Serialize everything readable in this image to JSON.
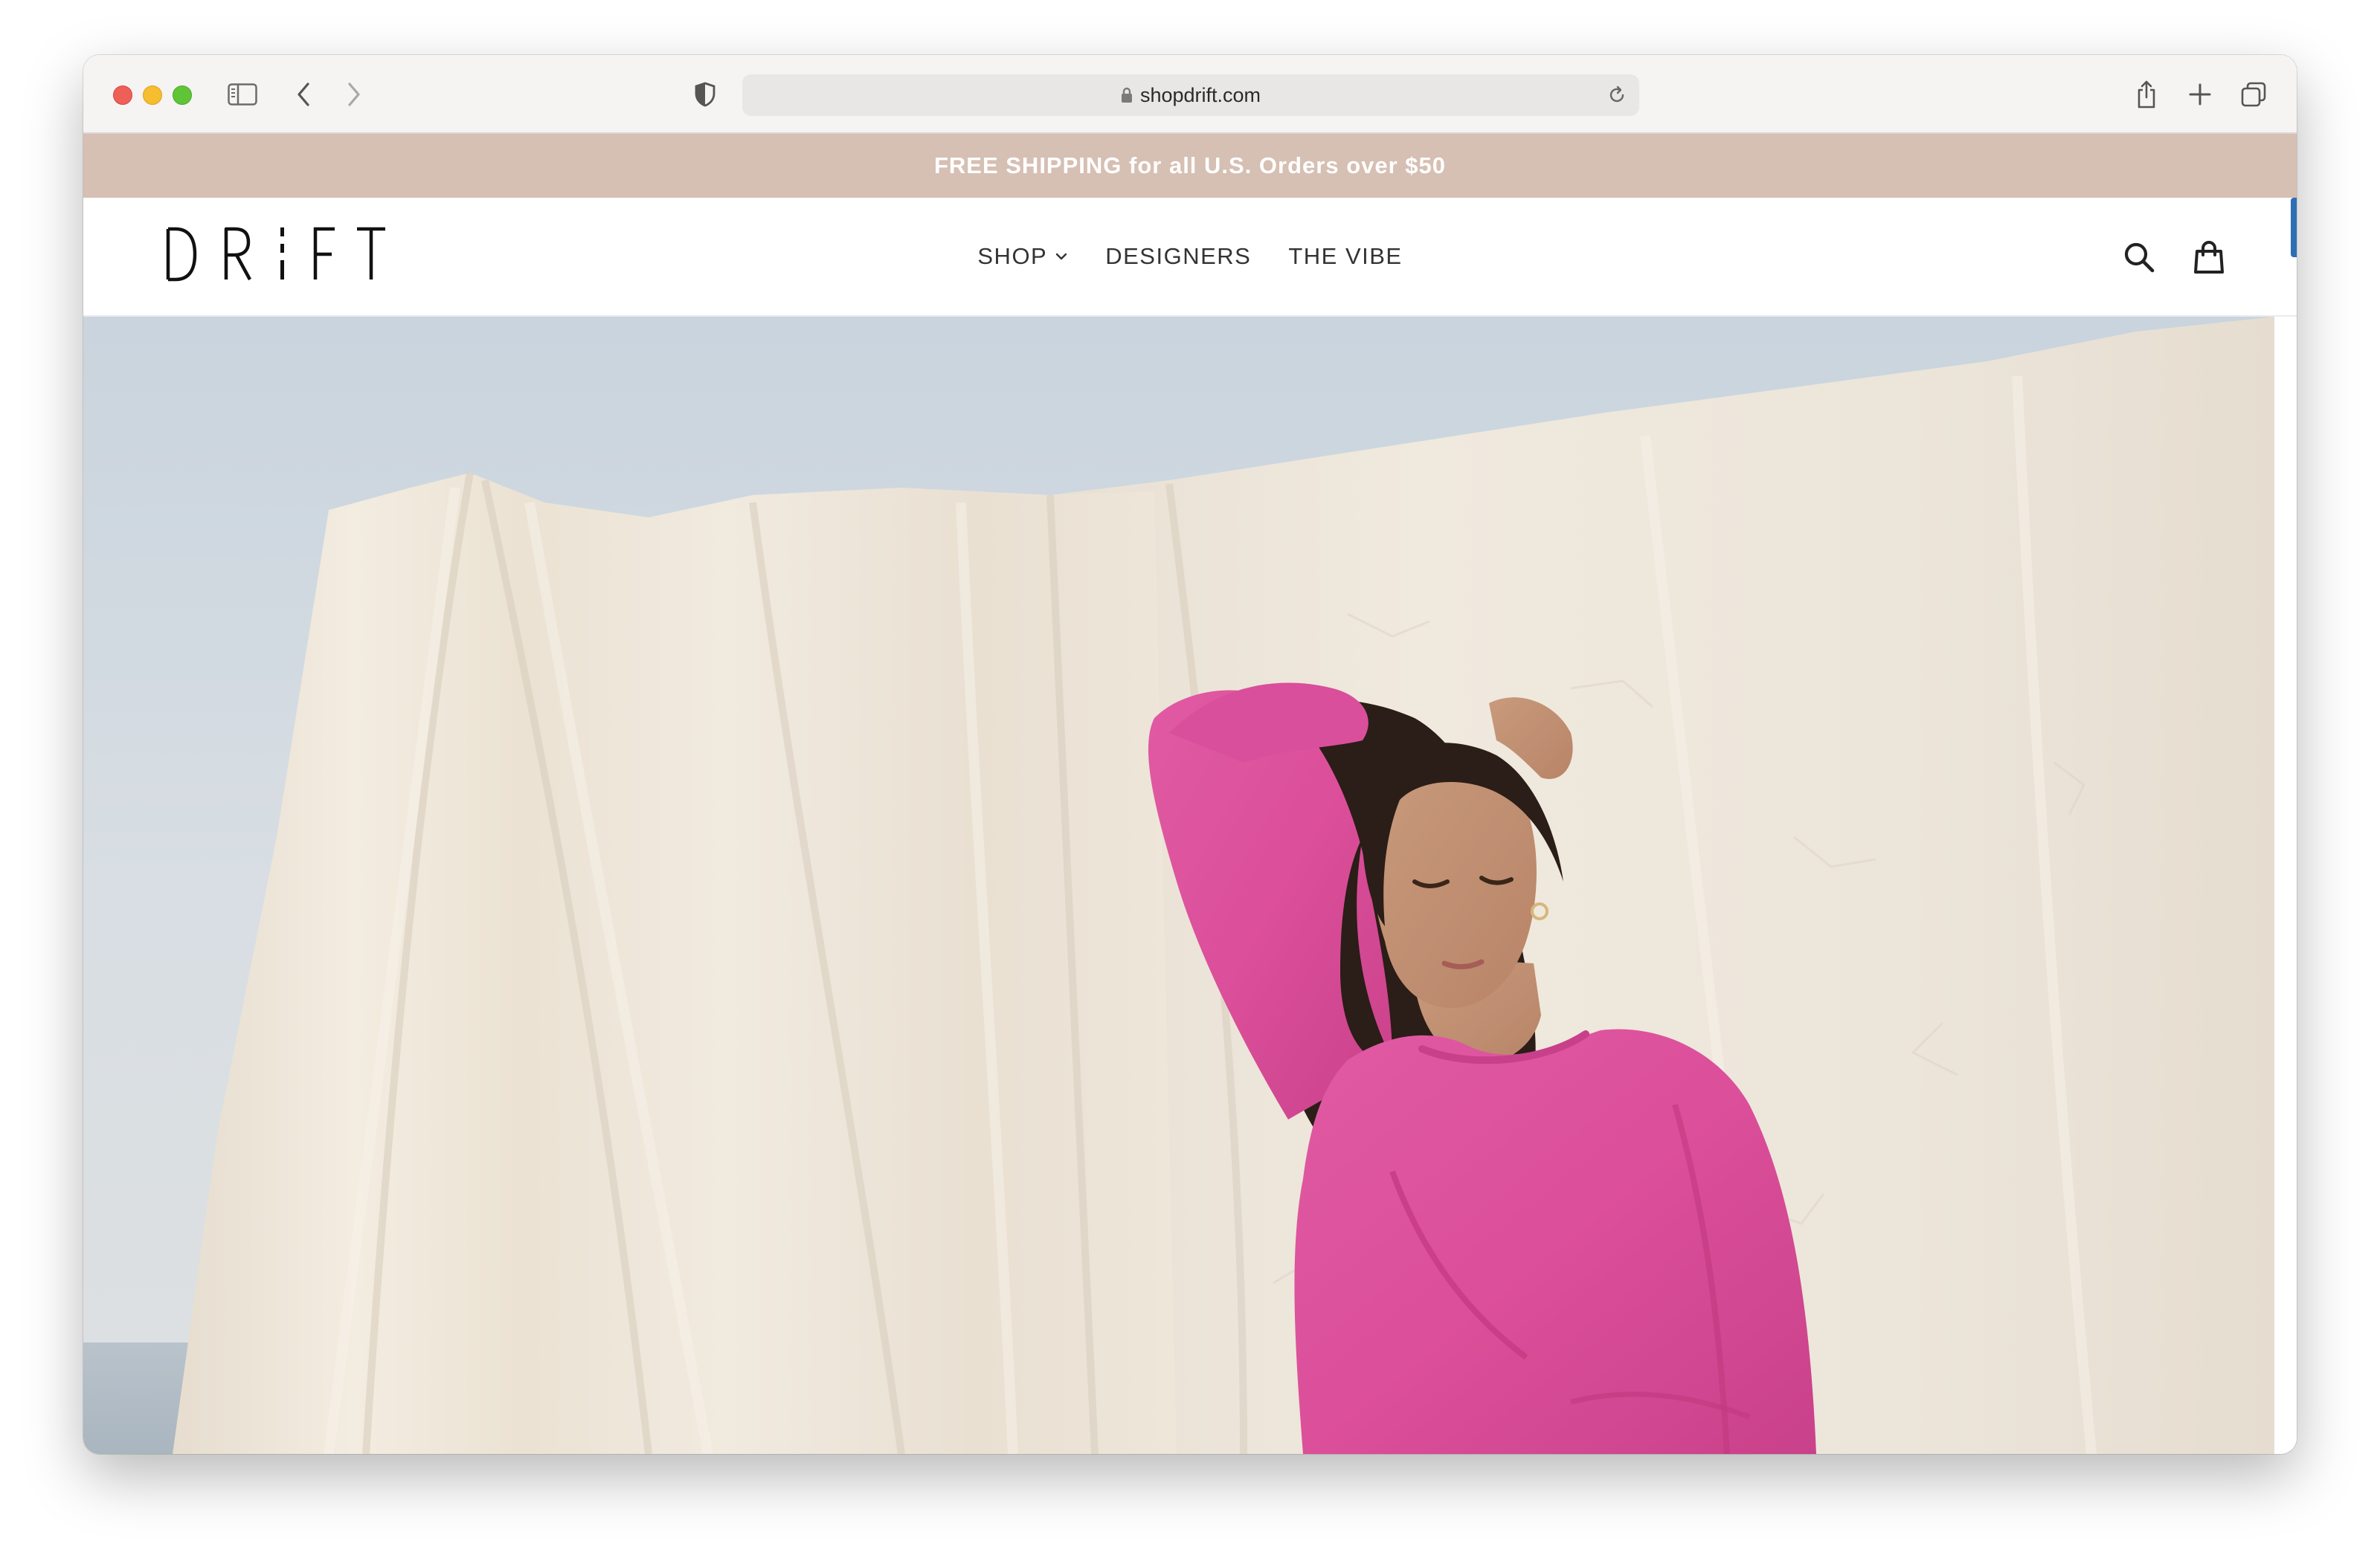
{
  "browser": {
    "url": "shopdrift.com"
  },
  "announcement": {
    "text": "FREE SHIPPING for all U.S. Orders over $50"
  },
  "header": {
    "logo_text": "DRIFT",
    "nav": [
      {
        "label": "SHOP",
        "has_dropdown": true
      },
      {
        "label": "DESIGNERS",
        "has_dropdown": false
      },
      {
        "label": "THE VIBE",
        "has_dropdown": false
      }
    ],
    "icons": [
      "search-icon",
      "cart-icon"
    ]
  },
  "colors": {
    "announcement_bg": "#d6bfb3",
    "announcement_text": "#ffffff",
    "sweater_pink": "#e0509e",
    "fabric": "#efe8dc",
    "sky": "#d3dbe2"
  },
  "hero": {
    "image_subject": "woman in pink sweatshirt in front of hanging cream fabric"
  }
}
